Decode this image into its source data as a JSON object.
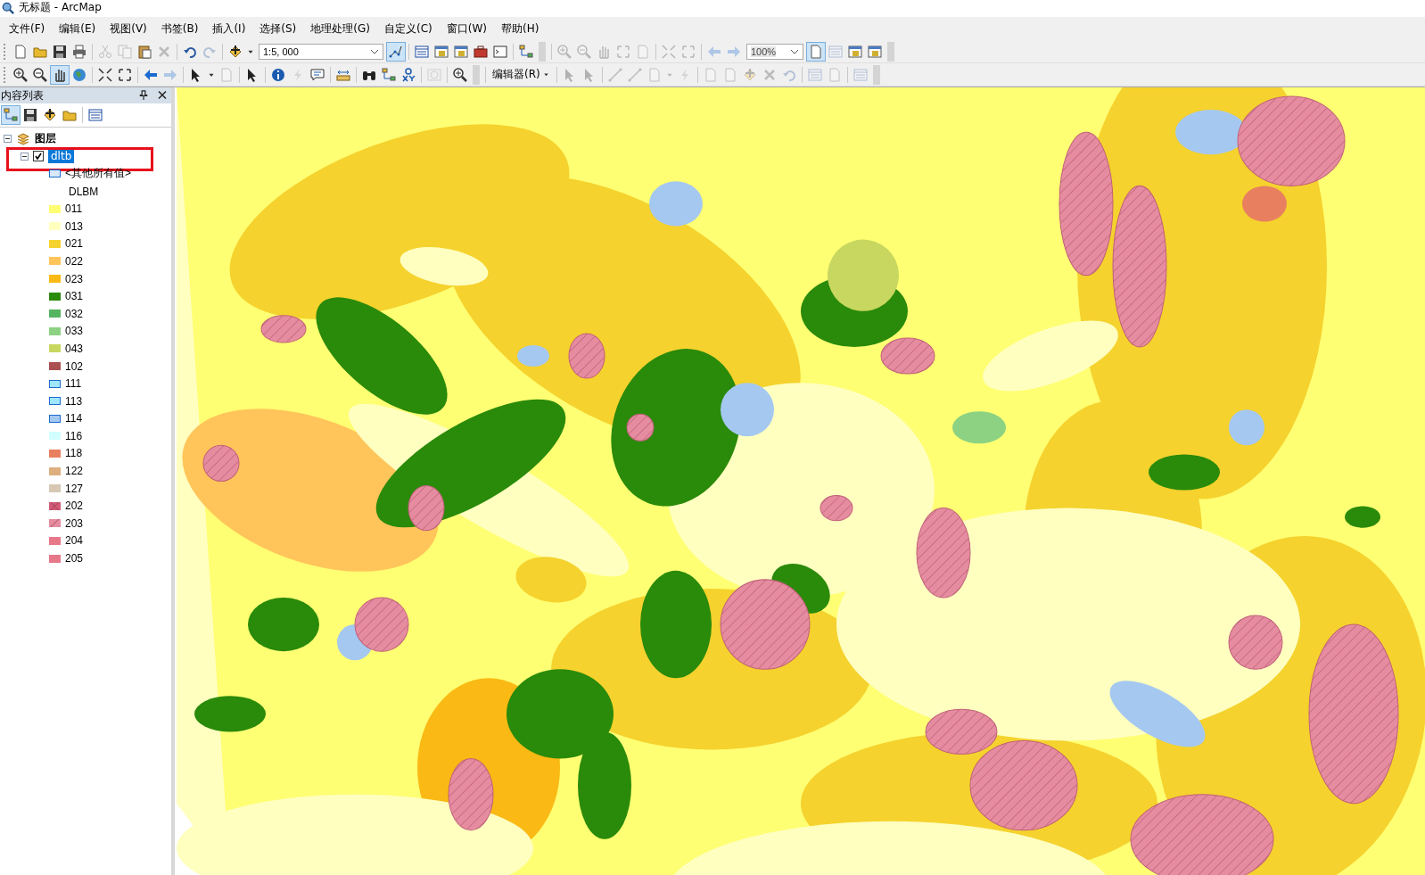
{
  "window": {
    "title": "无标题 - ArcMap"
  },
  "menu": [
    "文件(F)",
    "编辑(E)",
    "视图(V)",
    "书签(B)",
    "插入(I)",
    "选择(S)",
    "地理处理(G)",
    "自定义(C)",
    "窗口(W)",
    "帮助(H)"
  ],
  "toolbar_rows": [
    {
      "items": [
        {
          "kind": "page",
          "disabled": false
        },
        {
          "kind": "folder",
          "disabled": false
        },
        {
          "kind": "disk",
          "disabled": false
        },
        {
          "kind": "printer",
          "disabled": false
        },
        {
          "kind": "sep"
        },
        {
          "kind": "scissors",
          "disabled": true
        },
        {
          "kind": "copy",
          "disabled": true
        },
        {
          "kind": "clipboard",
          "disabled": false
        },
        {
          "kind": "xmark",
          "disabled": true
        },
        {
          "kind": "sep"
        },
        {
          "kind": "undo",
          "disabled": false
        },
        {
          "kind": "redo",
          "disabled": true
        },
        {
          "kind": "sep"
        },
        {
          "kind": "plus",
          "disabled": false
        },
        {
          "kind": "caret",
          "disabled": false
        },
        {
          "kind": "combo",
          "value": "1:5, 000",
          "disabled": false
        },
        {
          "kind": "pencil",
          "disabled": false,
          "selected": true
        },
        {
          "kind": "sep"
        },
        {
          "kind": "table",
          "disabled": false
        },
        {
          "kind": "window",
          "disabled": false
        },
        {
          "kind": "window",
          "disabled": false
        },
        {
          "kind": "toolbox",
          "disabled": false
        },
        {
          "kind": "terminal",
          "disabled": false
        },
        {
          "kind": "sep"
        },
        {
          "kind": "nodes",
          "disabled": false
        },
        {
          "kind": "grip"
        },
        {
          "kind": "sep"
        },
        {
          "kind": "zoomin",
          "disabled": true
        },
        {
          "kind": "zoomout",
          "disabled": true
        },
        {
          "kind": "hand",
          "disabled": true
        },
        {
          "kind": "arrowsout",
          "disabled": true
        },
        {
          "kind": "page",
          "disabled": true
        },
        {
          "kind": "sep"
        },
        {
          "kind": "arrowsin",
          "disabled": true
        },
        {
          "kind": "arrowsout",
          "disabled": true
        },
        {
          "kind": "sep"
        },
        {
          "kind": "left",
          "disabled": true
        },
        {
          "kind": "right",
          "disabled": true
        },
        {
          "kind": "combo",
          "value": "100%",
          "disabled": true
        },
        {
          "kind": "page",
          "disabled": false,
          "selected": true
        },
        {
          "kind": "table",
          "disabled": true
        },
        {
          "kind": "window",
          "disabled": false
        },
        {
          "kind": "window",
          "disabled": false
        },
        {
          "kind": "grip"
        }
      ]
    },
    {
      "items": [
        {
          "kind": "zoomin",
          "disabled": false
        },
        {
          "kind": "zoomout",
          "disabled": false
        },
        {
          "kind": "hand",
          "disabled": false,
          "selected": true
        },
        {
          "kind": "globe",
          "disabled": false
        },
        {
          "kind": "sep"
        },
        {
          "kind": "arrowsin",
          "disabled": false
        },
        {
          "kind": "arrowsout",
          "disabled": false
        },
        {
          "kind": "sep"
        },
        {
          "kind": "left",
          "disabled": false
        },
        {
          "kind": "right",
          "disabled": true
        },
        {
          "kind": "sep"
        },
        {
          "kind": "cursor",
          "disabled": false
        },
        {
          "kind": "caret",
          "disabled": false
        },
        {
          "kind": "page",
          "disabled": true
        },
        {
          "kind": "sep"
        },
        {
          "kind": "cursor",
          "disabled": false
        },
        {
          "kind": "sep"
        },
        {
          "kind": "info",
          "disabled": false
        },
        {
          "kind": "lightning",
          "disabled": true
        },
        {
          "kind": "bubble",
          "disabled": false
        },
        {
          "kind": "sep"
        },
        {
          "kind": "ruler",
          "disabled": false
        },
        {
          "kind": "sep"
        },
        {
          "kind": "binoculars",
          "disabled": false
        },
        {
          "kind": "nodes",
          "disabled": false
        },
        {
          "kind": "xy",
          "disabled": false
        },
        {
          "kind": "sep"
        },
        {
          "kind": "clock",
          "disabled": true
        },
        {
          "kind": "sep"
        },
        {
          "kind": "zoomin",
          "disabled": false
        },
        {
          "kind": "grip"
        },
        {
          "kind": "sep"
        },
        {
          "kind": "menu",
          "label": "编辑器(R)"
        },
        {
          "kind": "sep"
        },
        {
          "kind": "cursor",
          "disabled": true
        },
        {
          "kind": "cursor",
          "disabled": true
        },
        {
          "kind": "sep"
        },
        {
          "kind": "line",
          "disabled": true
        },
        {
          "kind": "line",
          "disabled": true
        },
        {
          "kind": "page",
          "disabled": true
        },
        {
          "kind": "caret",
          "disabled": true
        },
        {
          "kind": "lightning",
          "disabled": true
        },
        {
          "kind": "sep"
        },
        {
          "kind": "page",
          "disabled": true
        },
        {
          "kind": "page",
          "disabled": true
        },
        {
          "kind": "plus",
          "disabled": true
        },
        {
          "kind": "xmark",
          "disabled": true
        },
        {
          "kind": "undo",
          "disabled": true
        },
        {
          "kind": "sep"
        },
        {
          "kind": "table",
          "disabled": true
        },
        {
          "kind": "page",
          "disabled": true
        },
        {
          "kind": "sep"
        },
        {
          "kind": "table",
          "disabled": true
        },
        {
          "kind": "grip"
        }
      ]
    }
  ],
  "toc": {
    "title": "内容列表",
    "root": {
      "label": "图层",
      "expanded": true,
      "layer": {
        "label": "dltb",
        "expanded": true,
        "checked": true,
        "selected": true,
        "highlighted": true,
        "other_values": "<其他所有值>",
        "field": "DLBM",
        "classes": [
          {
            "label": "011",
            "color": "#ffff73",
            "kind": "fill"
          },
          {
            "label": "013",
            "color": "#ffffc0",
            "kind": "fill"
          },
          {
            "label": "021",
            "color": "#f5d22d",
            "kind": "fill"
          },
          {
            "label": "022",
            "color": "#ffc55a",
            "kind": "fill"
          },
          {
            "label": "023",
            "color": "#fab914",
            "kind": "fill"
          },
          {
            "label": "031",
            "color": "#2a8a0a",
            "kind": "fill"
          },
          {
            "label": "032",
            "color": "#55b45f",
            "kind": "fill"
          },
          {
            "label": "033",
            "color": "#8cd282",
            "kind": "fill"
          },
          {
            "label": "043",
            "color": "#c8d75f",
            "kind": "fill"
          },
          {
            "label": "102",
            "color": "#aa5050",
            "kind": "fill"
          },
          {
            "label": "111",
            "color": "#a0e6ff",
            "kind": "outlined"
          },
          {
            "label": "113",
            "color": "#a0e6ff",
            "kind": "outlined"
          },
          {
            "label": "114",
            "color": "#a5c8f0",
            "kind": "outlined"
          },
          {
            "label": "116",
            "color": "#d2ffff",
            "kind": "fill"
          },
          {
            "label": "118",
            "color": "#e88060",
            "kind": "fill"
          },
          {
            "label": "122",
            "color": "#dcaf7d",
            "kind": "fill"
          },
          {
            "label": "127",
            "color": "#d7c8b4",
            "kind": "fill"
          },
          {
            "label": "202",
            "color": "#d25a78",
            "kind": "crosshatch"
          },
          {
            "label": "203",
            "color": "#e68ca0",
            "kind": "hatch"
          },
          {
            "label": "204",
            "color": "#e6788a",
            "kind": "fill"
          },
          {
            "label": "205",
            "color": "#e6788a",
            "kind": "fill"
          }
        ]
      }
    }
  }
}
